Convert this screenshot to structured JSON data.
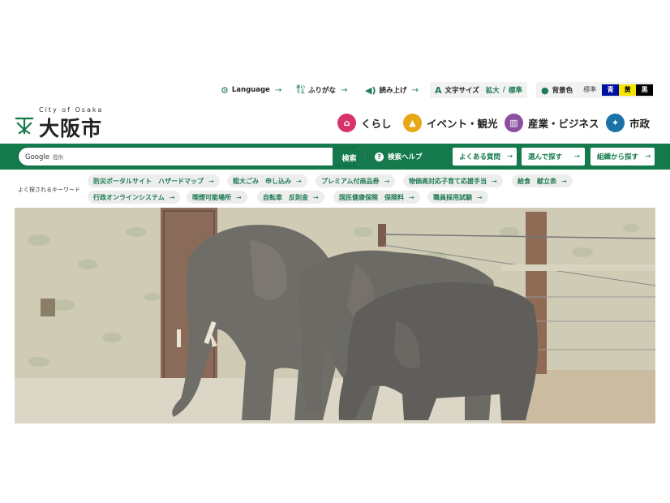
{
  "utility": {
    "language": "Language",
    "furigana_icon_top": "あい",
    "furigana_icon_bottom": "うえ",
    "furigana": "ふりがな",
    "read_aloud": "読み上げ",
    "text_size_label": "文字サイズ",
    "text_size_enlarge": "拡大",
    "text_size_sep": "/",
    "text_size_standard": "標準",
    "bg_color_label": "背景色",
    "bg_standard": "標準",
    "bg_blue": "青",
    "bg_yellow": "黄",
    "bg_black": "黒",
    "arrow": "→"
  },
  "logo": {
    "sub": "City of Osaka",
    "name": "大阪市"
  },
  "main_nav": [
    {
      "label": "くらし",
      "icon": "house-icon"
    },
    {
      "label": "イベント・観光",
      "icon": "castle-icon"
    },
    {
      "label": "産業・ビジネス",
      "icon": "building-icon"
    },
    {
      "label": "市政",
      "icon": "city-hall-icon"
    }
  ],
  "search": {
    "provider": "Google",
    "provider_suffix": "提供",
    "placeholder": "",
    "button": "検索",
    "help": "検索ヘルプ",
    "help_icon": "?"
  },
  "quick_buttons": [
    "よくある質問",
    "選んで探す",
    "組織から探す"
  ],
  "keywords": {
    "label": "よく探されるキーワード",
    "items": [
      "防災ポータルサイト　ハザードマップ",
      "粗大ごみ　申し込み",
      "プレミアム付商品券",
      "物価高対応子育て応援手当",
      "給食　献立表",
      "行政オンラインシステム",
      "喫煙可能場所",
      "自転車　反則金",
      "国民健康保険　保険料",
      "職員採用試験"
    ]
  },
  "hero": {
    "subject": "elephants-photo"
  },
  "colors": {
    "brand_green": "#147a4d",
    "kurashi": "#d6336c",
    "event": "#e8a717",
    "business": "#8a4f9e",
    "shisei": "#1a73a8"
  }
}
